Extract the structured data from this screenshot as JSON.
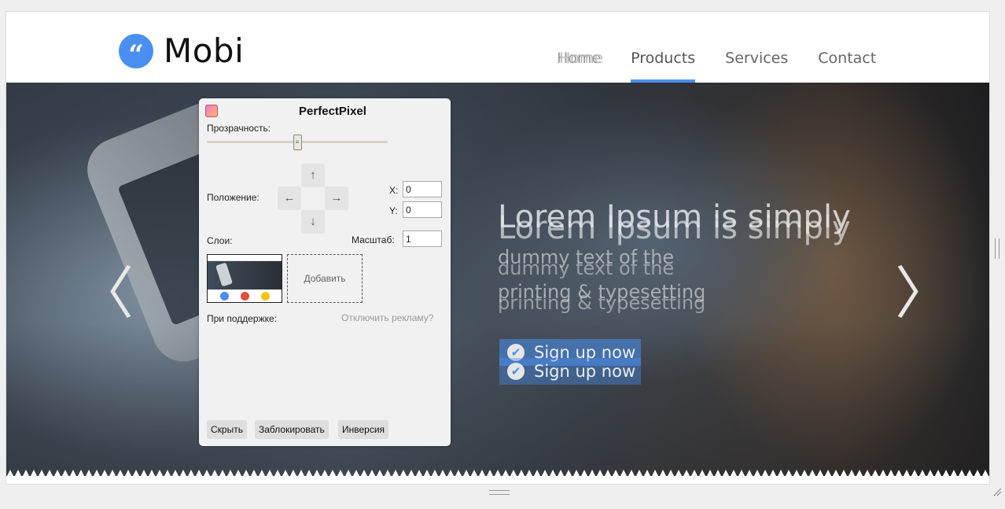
{
  "site": {
    "logo_glyph": "“",
    "logo_text": "Mobi",
    "brand_color": "#4a8ff0"
  },
  "nav": {
    "items": [
      {
        "label": "Home",
        "active": false
      },
      {
        "label": "Products",
        "active": true
      },
      {
        "label": "Services",
        "active": false
      },
      {
        "label": "Contact",
        "active": false
      }
    ]
  },
  "hero": {
    "headline": "Lorem Ipsum is simply",
    "sub_line1": "dummy text of the",
    "sub_line2": "printing & typesetting",
    "cta_label": "Sign up now",
    "arrow_left": "〈",
    "arrow_right": "〉"
  },
  "perfectpixel": {
    "title": "PerfectPixel",
    "opacity_label": "Прозрачность:",
    "position_label": "Положение:",
    "x_label": "X:",
    "y_label": "Y:",
    "x_value": "0",
    "y_value": "0",
    "layers_label": "Слои:",
    "scale_label": "Масштаб:",
    "scale_value": "1",
    "add_label": "Добавить",
    "support_label": "При поддержке:",
    "disable_ads_link": "Отключить рекламу?",
    "arrows": {
      "up": "↑",
      "down": "↓",
      "left": "←",
      "right": "→"
    },
    "buttons": {
      "hide": "Скрыть",
      "lock": "Заблокировать",
      "invert": "Инверсия"
    },
    "opacity_level": 0.5
  }
}
